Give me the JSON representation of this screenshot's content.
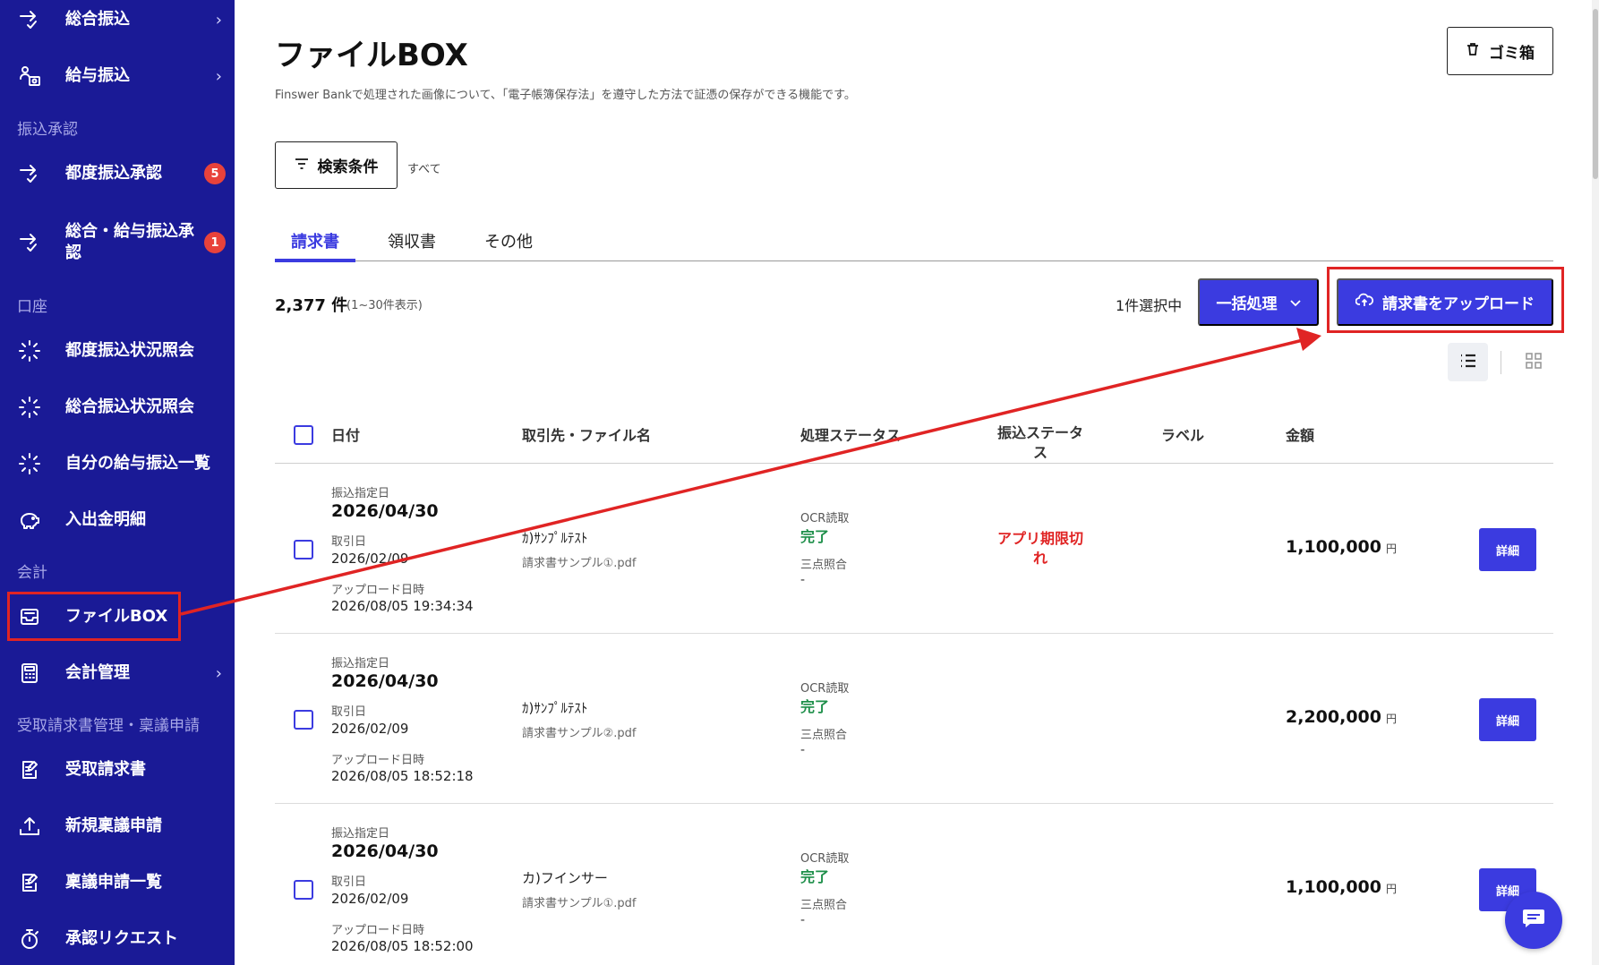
{
  "sidebar": {
    "items": [
      {
        "label": "総合振込",
        "icon": "transfer-arrow-icon",
        "chevron": "›"
      },
      {
        "label": "給与振込",
        "icon": "payroll-icon",
        "chevron": "›"
      },
      {
        "label": "都度振込承認",
        "icon": "transfer-arrow-icon",
        "badge": "5"
      },
      {
        "label": "総合・給与振込承認",
        "icon": "transfer-arrow-icon",
        "badge": "1"
      },
      {
        "label": "都度振込状況照会",
        "icon": "loading-spinner-icon"
      },
      {
        "label": "総合振込状況照会",
        "icon": "loading-spinner-icon"
      },
      {
        "label": "自分の給与振込一覧",
        "icon": "loading-spinner-icon"
      },
      {
        "label": "入出金明細",
        "icon": "piggy-bank-icon"
      },
      {
        "label": "ファイルBOX",
        "icon": "inbox-tray-icon"
      },
      {
        "label": "会計管理",
        "icon": "calculator-icon",
        "chevron": "›"
      },
      {
        "label": "受取請求書",
        "icon": "edit-document-icon"
      },
      {
        "label": "新規稟議申請",
        "icon": "upload-icon"
      },
      {
        "label": "稟議申請一覧",
        "icon": "edit-document-icon"
      },
      {
        "label": "承認リクエスト",
        "icon": "stopwatch-icon"
      }
    ],
    "sections": [
      "振込承認",
      "口座",
      "会計",
      "受取請求書管理・稟議申請"
    ]
  },
  "header": {
    "title": "ファイルBOX",
    "description": "Finswer Bankで処理された画像について、「電子帳簿保存法」を遵守した方法で証憑の保存ができる機能です。",
    "trash_label": "ゴミ箱"
  },
  "search": {
    "button_label": "検索条件",
    "summary": "すべて"
  },
  "tabs": [
    "請求書",
    "領収書",
    "その他"
  ],
  "toolbar": {
    "count": "2,377 件",
    "count_sub": "(1~30件表示)",
    "selected": "1件選択中",
    "bulk_label": "一括処理",
    "upload_label": "請求書をアップロード"
  },
  "table": {
    "headers": {
      "date": "日付",
      "vendor": "取引先・ファイル名",
      "process_status": "処理ステータス",
      "transfer_status": "振込ステータス",
      "label": "ラベル",
      "amount": "金額"
    },
    "field_labels": {
      "designated": "振込指定日",
      "transaction": "取引日",
      "uploaded": "アップロード日時",
      "ocr": "OCR読取",
      "three_way": "三点照合",
      "yen": "円",
      "detail": "詳細"
    },
    "rows": [
      {
        "designated_date": "2026/04/30",
        "transaction_date": "2026/02/09",
        "uploaded_at": "2026/08/05 19:34:34",
        "vendor": "ｶ)ｻﾝﾌﾟﾙﾃｽﾄ",
        "file": "請求書サンプル①.pdf",
        "ocr_status": "完了",
        "three_way": "-",
        "transfer_status": "アプリ期限切れ",
        "amount": "1,100,000"
      },
      {
        "designated_date": "2026/04/30",
        "transaction_date": "2026/02/09",
        "uploaded_at": "2026/08/05 18:52:18",
        "vendor": "ｶ)ｻﾝﾌﾟﾙﾃｽﾄ",
        "file": "請求書サンプル②.pdf",
        "ocr_status": "完了",
        "three_way": "-",
        "transfer_status": "",
        "amount": "2,200,000"
      },
      {
        "designated_date": "2026/04/30",
        "transaction_date": "2026/02/09",
        "uploaded_at": "2026/08/05 18:52:00",
        "vendor": "カ)フインサー",
        "file": "請求書サンプル①.pdf",
        "ocr_status": "完了",
        "three_way": "-",
        "transfer_status": "",
        "amount": "1,100,000"
      }
    ]
  },
  "colors": {
    "sidebar_bg": "#1a1a96",
    "accent": "#3b3be0",
    "badge": "#e8423b",
    "annotation": "#e02424",
    "success": "#1e8f4a"
  }
}
